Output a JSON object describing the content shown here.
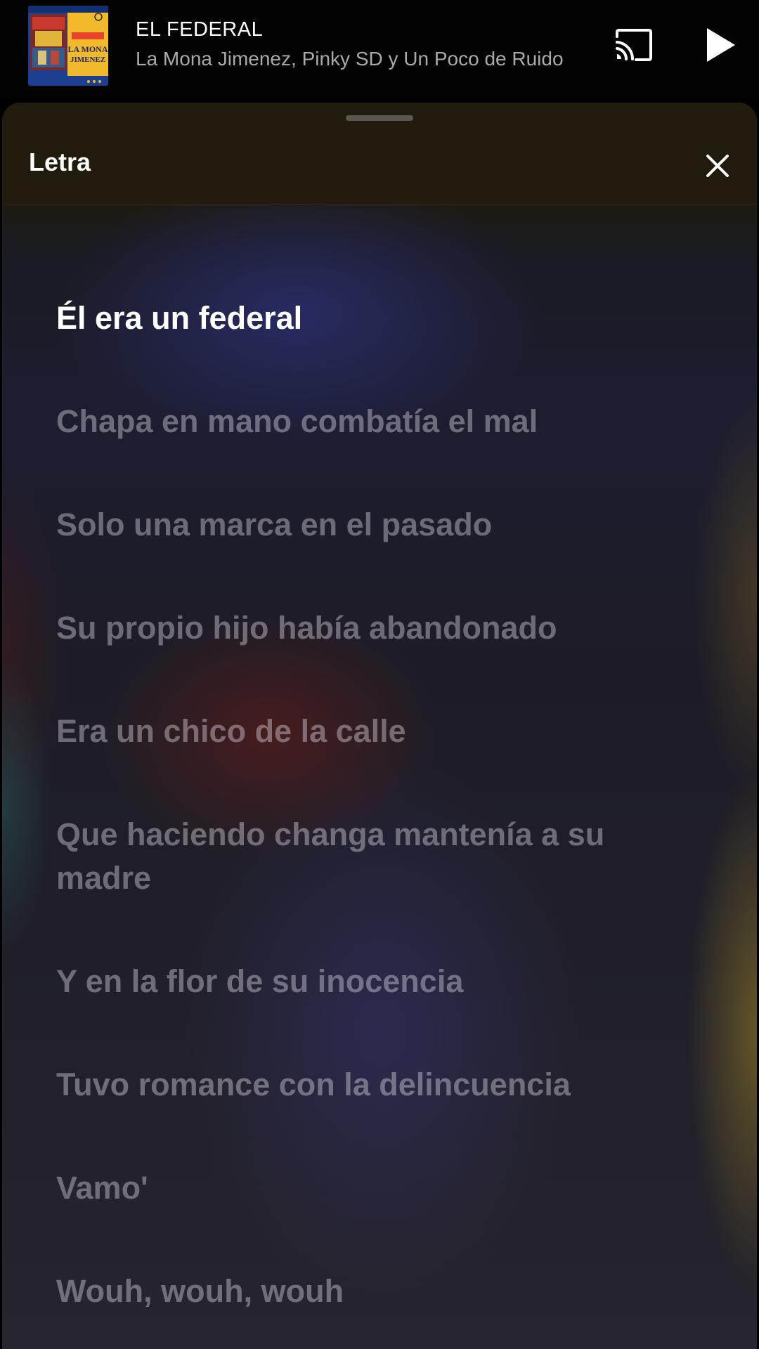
{
  "now_playing": {
    "title": "EL FEDERAL",
    "artists": "La Mona Jimenez, Pinky SD y Un Poco de Ruido",
    "album_art_text": [
      "LA MONA",
      "JIMENEZ"
    ]
  },
  "controls": {
    "cast_icon": "cast-icon",
    "play_icon": "play-icon"
  },
  "lyrics_sheet": {
    "title": "Letra",
    "close_icon": "close-icon",
    "lines": [
      "Él era un federal",
      "Chapa en mano combatía el mal",
      "Solo una marca en el pasado",
      "Su propio hijo había abandonado",
      "Era un chico de la calle",
      "Que haciendo changa mantenía a su madre",
      "Y en la flor de su inocencia",
      "Tuvo romance con la delincuencia",
      "Vamo'",
      "Wouh, wouh, wouh"
    ],
    "active_line_index": 0
  },
  "colors": {
    "background": "#000000",
    "sheet_header": "#201b0d",
    "active_lyric": "#ffffff",
    "inactive_lyric": "#8e8a92",
    "artist_text": "#a9a9a9"
  }
}
